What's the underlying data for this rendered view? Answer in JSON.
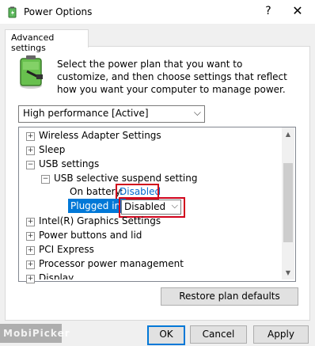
{
  "window": {
    "title": "Power Options",
    "help": "?",
    "close": "✕"
  },
  "tab": {
    "label": "Advanced settings"
  },
  "description": "Select the power plan that you want to customize, and then choose settings that reflect how you want your computer to manage power.",
  "plan_select": {
    "value": "High performance [Active]",
    "arrow": "⌵"
  },
  "tree": {
    "wireless": "Wireless Adapter Settings",
    "sleep": "Sleep",
    "usb": "USB settings",
    "usb_suspend": "USB selective suspend setting",
    "on_battery_label": "On battery:",
    "on_battery_value": "Disabled",
    "plugged_in_label": "Plugged in:",
    "plugged_in_value": "Disabled",
    "intel": "Intel(R) Graphics Settings",
    "power_buttons": "Power buttons and lid",
    "pci": "PCI Express",
    "processor": "Processor power management",
    "display": "Display",
    "plus": "+",
    "minus": "−"
  },
  "scroll": {
    "up": "▲",
    "down": "▼"
  },
  "buttons": {
    "restore": "Restore plan defaults",
    "ok": "OK",
    "cancel": "Cancel",
    "apply": "Apply"
  },
  "watermark": "MobiPicker",
  "colors": {
    "highlight": "#0078d7",
    "link": "#0066cc",
    "annotation_red": "#d0021b"
  }
}
